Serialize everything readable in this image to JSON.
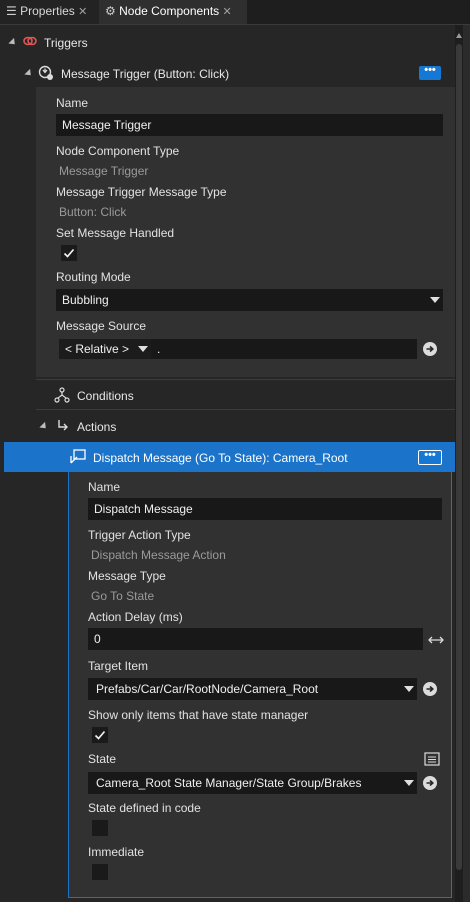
{
  "tabs": [
    {
      "label": "Properties",
      "close": "✕"
    },
    {
      "label": "Node Components",
      "close": "✕"
    }
  ],
  "tree": {
    "triggers_label": "Triggers",
    "message_trigger": {
      "label": "Message Trigger (Button: Click)",
      "more_button": "•••",
      "name_label": "Name",
      "name_value": "Message Trigger",
      "component_type_label": "Node Component Type",
      "component_type_value": "Message Trigger",
      "message_type_label": "Message Trigger Message Type",
      "message_type_value": "Button: Click",
      "set_handled_label": "Set Message Handled",
      "set_handled_checked": true,
      "routing_label": "Routing Mode",
      "routing_value": "Bubbling",
      "source_label": "Message Source",
      "source_relative": "< Relative >",
      "source_path": "."
    },
    "conditions_label": "Conditions",
    "actions_label": "Actions",
    "dispatch": {
      "label": "Dispatch Message (Go To State): Camera_Root",
      "more_button": "•••",
      "name_label": "Name",
      "name_value": "Dispatch Message",
      "action_type_label": "Trigger Action Type",
      "action_type_value": "Dispatch Message Action",
      "message_type_label": "Message Type",
      "message_type_value": "Go To State",
      "delay_label": "Action Delay (ms)",
      "delay_value": "0",
      "target_label": "Target Item",
      "target_value": "Prefabs/Car/Car/RootNode/Camera_Root",
      "show_only_label": "Show only items that have state manager",
      "show_only_checked": true,
      "state_label": "State",
      "state_value": "Camera_Root State Manager/State Group/Brakes",
      "state_defined_label": "State defined in code",
      "state_defined_checked": false,
      "immediate_label": "Immediate",
      "immediate_checked": false
    }
  },
  "colors": {
    "accent": "#1478d4",
    "selected_row": "#1b74c9",
    "trigger_icon": "#e25555"
  }
}
